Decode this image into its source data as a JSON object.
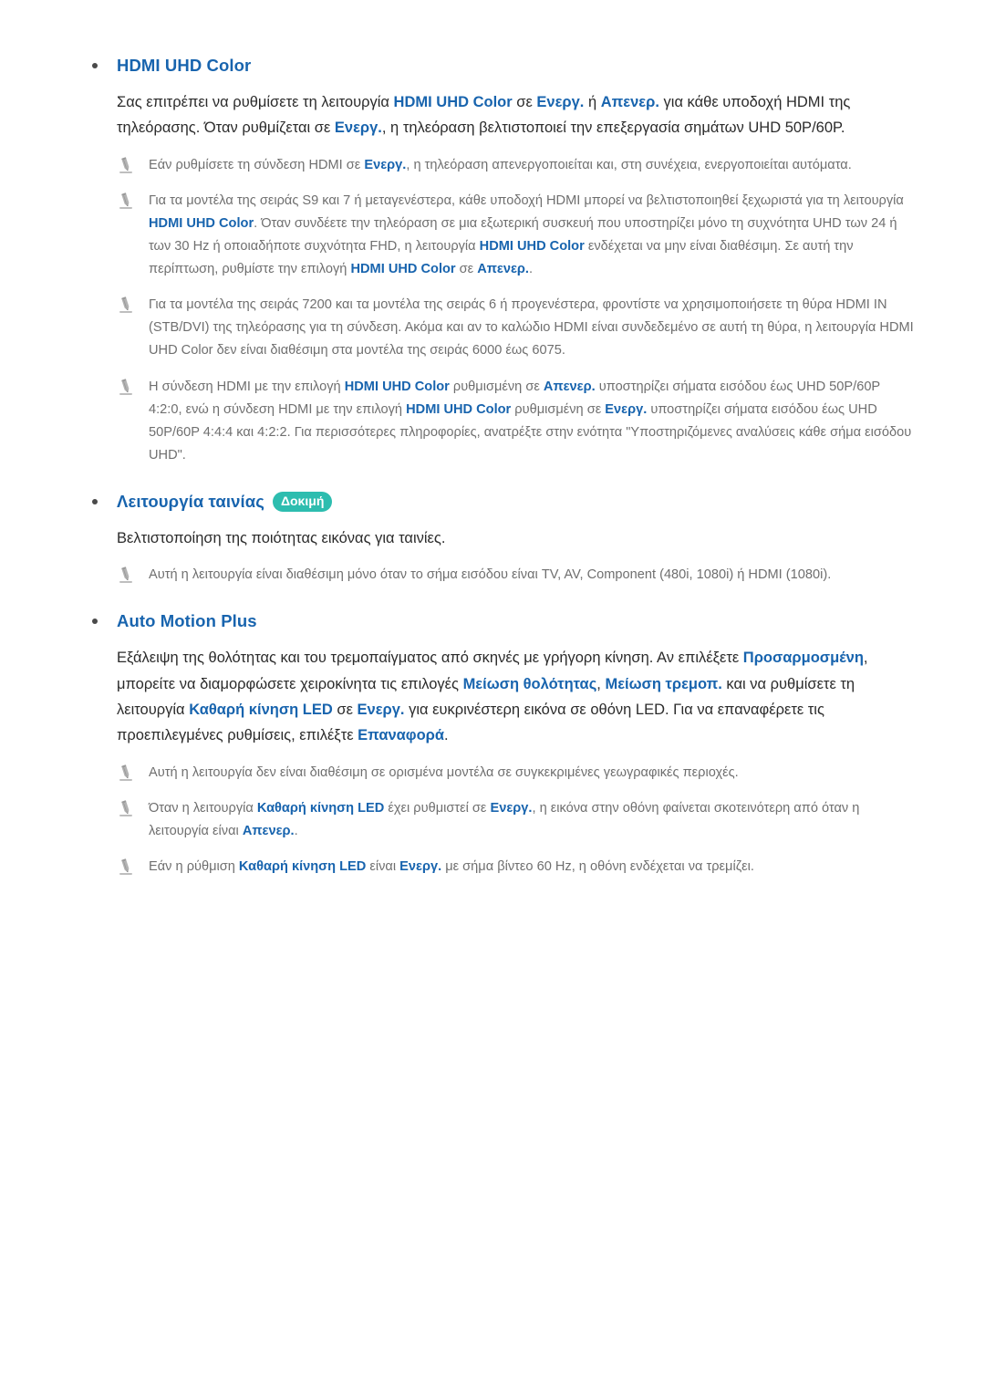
{
  "page": {
    "language": "el",
    "colors": {
      "accent_blue": "#1864ae",
      "body_text": "#2b2b2b",
      "note_text": "#6f6f6f",
      "badge_teal": "#2dbdaf",
      "bullet": "#4a4a4a"
    }
  },
  "sections": [
    {
      "id": "hdmi-uhd-color",
      "heading": "HDMI UHD Color",
      "badge": null,
      "body": [
        {
          "t": "Σας επιτρέπει να ρυθμίσετε τη λειτουργία ",
          "b": false
        },
        {
          "t": "HDMI UHD Color",
          "b": true
        },
        {
          "t": " σε ",
          "b": false
        },
        {
          "t": "Ενεργ.",
          "b": true
        },
        {
          "t": " ή ",
          "b": false
        },
        {
          "t": "Απενερ.",
          "b": true
        },
        {
          "t": " για κάθε υποδοχή HDMI της τηλεόρασης. Όταν ρυθμίζεται σε ",
          "b": false
        },
        {
          "t": "Ενεργ.",
          "b": true
        },
        {
          "t": ", η τηλεόραση βελτιστοποιεί την επεξεργασία σημάτων UHD 50P/60P.",
          "b": false
        }
      ],
      "notes": [
        [
          {
            "t": "Εάν ρυθμίσετε τη σύνδεση HDMI σε ",
            "b": false
          },
          {
            "t": "Ενεργ.",
            "b": true
          },
          {
            "t": ", η τηλεόραση απενεργοποιείται και, στη συνέχεια, ενεργοποιείται αυτόματα.",
            "b": false
          }
        ],
        [
          {
            "t": "Για τα μοντέλα της σειράς S9 και 7 ή μεταγενέστερα, κάθε υποδοχή HDMI μπορεί να βελτιστοποιηθεί ξεχωριστά για τη λειτουργία ",
            "b": false
          },
          {
            "t": "HDMI UHD Color",
            "b": true
          },
          {
            "t": ". Όταν συνδέετε την τηλεόραση σε μια εξωτερική συσκευή που υποστηρίζει μόνο τη συχνότητα UHD των 24 ή των 30 Hz ή οποιαδήποτε συχνότητα FHD, η λειτουργία ",
            "b": false
          },
          {
            "t": "HDMI UHD Color",
            "b": true
          },
          {
            "t": " ενδέχεται να μην είναι διαθέσιμη. Σε αυτή την περίπτωση, ρυθμίστε την επιλογή ",
            "b": false
          },
          {
            "t": "HDMI UHD Color",
            "b": true
          },
          {
            "t": " σε ",
            "b": false
          },
          {
            "t": "Απενερ.",
            "b": true
          },
          {
            "t": ".",
            "b": false
          }
        ],
        [
          {
            "t": "Για τα μοντέλα της σειράς 7200 και τα μοντέλα της σειράς 6 ή προγενέστερα, φροντίστε να χρησιμοποιήσετε τη θύρα HDMI IN (STB/DVI) της τηλεόρασης για τη σύνδεση. Ακόμα και αν το καλώδιο HDMI είναι συνδεδεμένο σε αυτή τη θύρα, η λειτουργία HDMI UHD Color δεν είναι διαθέσιμη στα μοντέλα της σειράς 6000 έως 6075.",
            "b": false
          }
        ],
        [
          {
            "t": "Η σύνδεση HDMI με την επιλογή ",
            "b": false
          },
          {
            "t": "HDMI UHD Color",
            "b": true
          },
          {
            "t": " ρυθμισμένη σε ",
            "b": false
          },
          {
            "t": "Απενερ.",
            "b": true
          },
          {
            "t": " υποστηρίζει σήματα εισόδου έως UHD 50P/60P 4:2:0, ενώ η σύνδεση HDMI με την επιλογή ",
            "b": false
          },
          {
            "t": "HDMI UHD Color",
            "b": true
          },
          {
            "t": " ρυθμισμένη σε ",
            "b": false
          },
          {
            "t": "Ενεργ.",
            "b": true
          },
          {
            "t": " υποστηρίζει σήματα εισόδου έως UHD 50P/60P 4:4:4 και 4:2:2. Για περισσότερες πληροφορίες, ανατρέξτε στην ενότητα \"Υποστηριζόμενες αναλύσεις κάθε σήμα εισόδου UHD\".",
            "b": false
          }
        ]
      ]
    },
    {
      "id": "movie-mode",
      "heading": "Λειτουργία ταινίας",
      "badge": "Δοκιμή",
      "body": [
        {
          "t": "Βελτιστοποίηση της ποιότητας εικόνας για ταινίες.",
          "b": false
        }
      ],
      "notes": [
        [
          {
            "t": "Αυτή η λειτουργία είναι διαθέσιμη μόνο όταν το σήμα εισόδου είναι TV, AV, Component (480i, 1080i) ή HDMI (1080i).",
            "b": false
          }
        ]
      ]
    },
    {
      "id": "auto-motion-plus",
      "heading": "Auto Motion Plus",
      "badge": null,
      "body": [
        {
          "t": "Εξάλειψη της θολότητας και του τρεμοπαίγματος από σκηνές με γρήγορη κίνηση. Αν επιλέξετε ",
          "b": false
        },
        {
          "t": "Προσαρμοσμένη",
          "b": true
        },
        {
          "t": ", μπορείτε να διαμορφώσετε χειροκίνητα τις επιλογές ",
          "b": false
        },
        {
          "t": "Μείωση θολότητας",
          "b": true
        },
        {
          "t": ", ",
          "b": false
        },
        {
          "t": "Μείωση τρεμοπ.",
          "b": true
        },
        {
          "t": " και να ρυθμίσετε τη λειτουργία ",
          "b": false
        },
        {
          "t": "Καθαρή κίνηση LED",
          "b": true
        },
        {
          "t": " σε ",
          "b": false
        },
        {
          "t": "Ενεργ.",
          "b": true
        },
        {
          "t": " για ευκρινέστερη εικόνα σε οθόνη LED. Για να επαναφέρετε τις προεπιλεγμένες ρυθμίσεις, επιλέξτε ",
          "b": false
        },
        {
          "t": "Επαναφορά",
          "b": true
        },
        {
          "t": ".",
          "b": false
        }
      ],
      "notes": [
        [
          {
            "t": "Αυτή η λειτουργία δεν είναι διαθέσιμη σε ορισμένα μοντέλα σε συγκεκριμένες γεωγραφικές περιοχές.",
            "b": false
          }
        ],
        [
          {
            "t": "Όταν η λειτουργία ",
            "b": false
          },
          {
            "t": "Καθαρή κίνηση LED",
            "b": true
          },
          {
            "t": " έχει ρυθμιστεί σε ",
            "b": false
          },
          {
            "t": "Ενεργ.",
            "b": true
          },
          {
            "t": ", η εικόνα στην οθόνη φαίνεται σκοτεινότερη από όταν η λειτουργία είναι ",
            "b": false
          },
          {
            "t": "Απενερ.",
            "b": true
          },
          {
            "t": ".",
            "b": false
          }
        ],
        [
          {
            "t": "Εάν η ρύθμιση ",
            "b": false
          },
          {
            "t": "Καθαρή κίνηση LED",
            "b": true
          },
          {
            "t": " είναι ",
            "b": false
          },
          {
            "t": "Ενεργ.",
            "b": true
          },
          {
            "t": " με σήμα βίντεο 60 Hz, η οθόνη ενδέχεται να τρεμίζει.",
            "b": false
          }
        ]
      ]
    }
  ],
  "icons": {
    "note": "pencil-icon",
    "bullet": "bullet-dot-icon"
  }
}
